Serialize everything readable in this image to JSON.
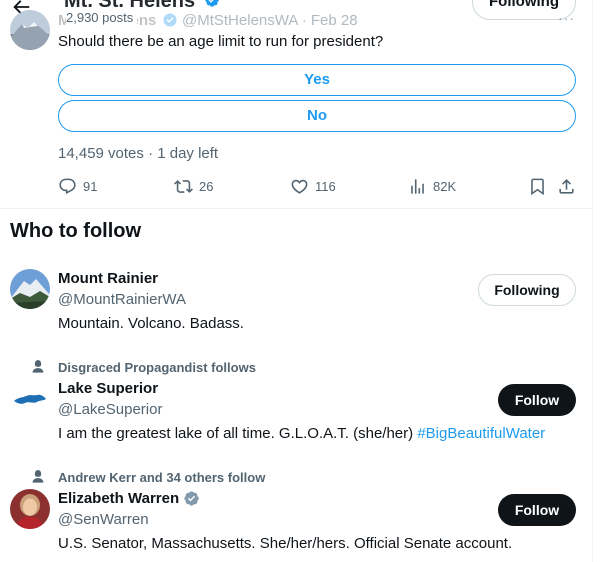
{
  "header": {
    "name": "Mt. St. Helens",
    "posts": "2,930 posts",
    "follow_state": "Following"
  },
  "post": {
    "author_name": "Mt. St. Helens",
    "handle": "@MtStHelensWA",
    "date": "Feb 28",
    "text": "Should there be an age limit to run for president?",
    "poll_options": [
      "Yes",
      "No"
    ],
    "poll_meta": "14,459 votes · 1 day left",
    "replies": "91",
    "reposts": "26",
    "likes": "116",
    "views": "82K"
  },
  "who_to_follow": {
    "title": "Who to follow",
    "users": [
      {
        "name": "Mount Rainier",
        "handle": "@MountRainierWA",
        "bio": "Mountain. Volcano. Badass.",
        "button": "Following"
      },
      {
        "social_context": "Disgraced Propagandist follows",
        "name": "Lake Superior",
        "handle": "@LakeSuperior",
        "bio": "I am the greatest lake of all time. G.L.O.A.T. (she/her)",
        "bio_hashtag": "#BigBeautifulWater",
        "button": "Follow"
      },
      {
        "social_context": "Andrew Kerr and 34 others follow",
        "name": "Elizabeth Warren",
        "handle": "@SenWarren",
        "bio": "U.S. Senator, Massachusetts. She/her/hers. Official Senate account.",
        "button": "Follow"
      }
    ]
  },
  "colors": {
    "accent": "#1d9bf0",
    "text_primary": "#0f1419",
    "text_secondary": "#536471",
    "follow_button": "#0f1419",
    "verified_gray": "#829aab"
  }
}
